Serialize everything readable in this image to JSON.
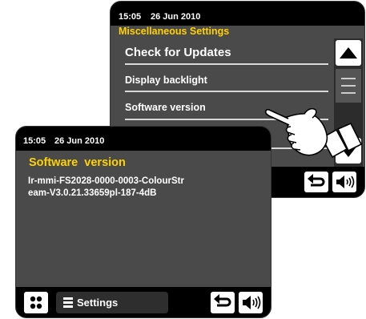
{
  "back_screen": {
    "status": {
      "time": "15:05",
      "date": "26 Jun 2010"
    },
    "heading": "Miscellaneous Settings",
    "menu_items": [
      "Check for Updates",
      "Display backlight",
      "Software version"
    ],
    "scroll_up_icon": "triangle-up",
    "scroll_down_icon": "triangle-down",
    "back_icon": "back-arrow",
    "volume_icon": "speaker"
  },
  "front_screen": {
    "status": {
      "time": "15:05",
      "date": "26 Jun 2010"
    },
    "title": "Software  version",
    "value_lines": [
      "Ir-mmi-FS2028-0000-0003-ColourStr",
      "eam-V3.0.21.33659pl-187-4dB"
    ],
    "home_icon": "grid",
    "settings_icon": "menu-lines",
    "settings_label": "Settings",
    "back_icon": "back-arrow",
    "volume_icon": "speaker"
  },
  "accent_color": "#ffd200",
  "pointer_icon": "pointing-hand"
}
